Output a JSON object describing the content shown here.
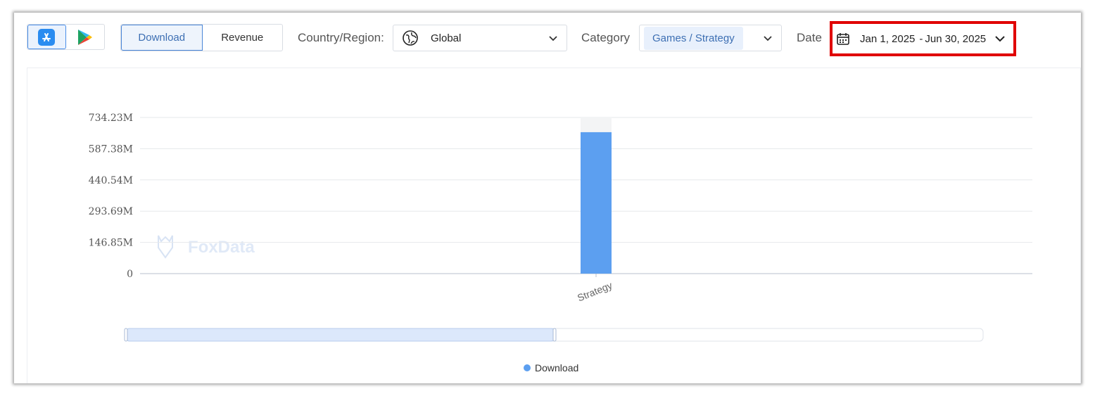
{
  "toolbar": {
    "stores": [
      {
        "name": "App Store",
        "icon": "app-store-icon",
        "active": true
      },
      {
        "name": "Google Play",
        "icon": "google-play-icon",
        "active": false
      }
    ],
    "metric_tabs": [
      "Download",
      "Revenue"
    ],
    "country_label": "Country/Region:",
    "country_value": "Global",
    "category_label": "Category",
    "category_value": "Games / Strategy",
    "date_label": "Date",
    "date_start": "Jan 1, 2025",
    "date_sep": "-",
    "date_end": "Jun 30, 2025"
  },
  "watermark": "FoxData",
  "colors": {
    "bar": "#5c9ff0",
    "bar_bg": "#f3f4f5",
    "grid": "#e6e8eb",
    "highlight": "#e00000"
  },
  "chart_data": {
    "type": "bar",
    "categories": [
      "Strategy"
    ],
    "series": [
      {
        "name": "Download",
        "values": [
          665
        ]
      }
    ],
    "yticks": [
      "0",
      "146.85M",
      "293.69M",
      "440.54M",
      "587.38M",
      "734.23M"
    ],
    "ylim": [
      0,
      734.23
    ],
    "yunit": "M",
    "legend": "bottom-center",
    "grid": true,
    "zoom_range_fraction": [
      0,
      0.5
    ]
  }
}
